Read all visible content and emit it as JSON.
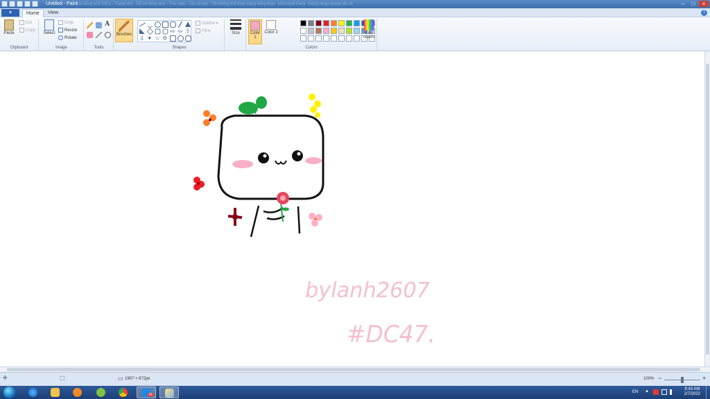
{
  "window": {
    "title": "Untitled - Paint",
    "controls": {
      "minimize": "–",
      "maximize": "□",
      "close": "×"
    },
    "background_tabs": [
      "Tải tiếng anh 2021 - Trang chủ",
      "Tải về tiếng anh - Thư viện - Tải về học",
      "Tôi không thể thấy trang tiếng thạo",
      "Microsoft Paint",
      "Đăng nhập nhanh để vẽ"
    ]
  },
  "ribbon": {
    "file_label": "▾",
    "tabs": [
      {
        "label": "Home",
        "active": true
      },
      {
        "label": "View",
        "active": false
      }
    ],
    "help": "?",
    "clipboard": {
      "paste": "Paste",
      "cut": "Cut",
      "copy": "Copy",
      "label": "Clipboard"
    },
    "image": {
      "select": "Select",
      "crop": "Crop",
      "resize": "Resize",
      "rotate": "Rotate",
      "label": "Image"
    },
    "tools": {
      "label": "Tools",
      "brushes": "Brushes"
    },
    "shapes": {
      "outline": "Outline",
      "fill": "Fill",
      "label": "Shapes"
    },
    "size": {
      "label": "Size"
    },
    "colors": {
      "color1_label": "Color 1",
      "color2_label": "Color 2",
      "edit_colors": "Edit colors",
      "label": "Colors",
      "color1": "#f6a7bd",
      "color2": "#ffffff",
      "palette": [
        "#000000",
        "#7f7f7f",
        "#880015",
        "#ed1c24",
        "#ff7f27",
        "#fff200",
        "#22b14c",
        "#00a2e8",
        "#3f48cc",
        "#a349a4",
        "#ffffff",
        "#c3c3c3",
        "#b97a57",
        "#ffaec9",
        "#ffc90e",
        "#efe4b0",
        "#b5e61d",
        "#99d9ea",
        "#7092be",
        "#c8bfe7",
        "#ffffff",
        "#ffffff",
        "#ffffff",
        "#ffffff",
        "#ffffff",
        "#ffffff",
        "#ffffff",
        "#ffffff",
        "#ffffff",
        "#ffffff"
      ]
    }
  },
  "canvas": {
    "handwriting": "bylanh2607 #DC47."
  },
  "statusbar": {
    "dimensions": "1907 × 872px",
    "zoom": "100%",
    "zoom_out": "−",
    "zoom_in": "+"
  },
  "taskbar": {
    "apps": [
      "start",
      "internet-explorer",
      "file-explorer",
      "media-player",
      "zalo-lite",
      "chrome",
      "zalo",
      "paint"
    ],
    "lang": "EN",
    "time": "8:43 AM",
    "date": "2/7/2022",
    "badge": "16"
  }
}
